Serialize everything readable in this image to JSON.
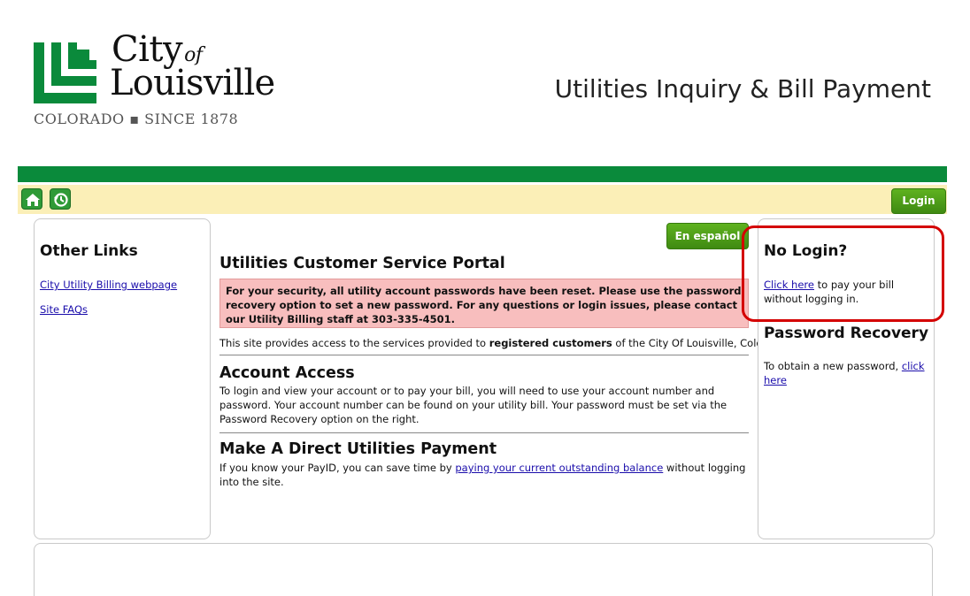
{
  "header": {
    "logo": {
      "city": "City",
      "of": "of",
      "louisville": "Louisville",
      "tagline": "COLORADO ▪ SINCE 1878"
    },
    "app_title": "Utilities Inquiry & Bill Payment"
  },
  "colors": {
    "brand_green": "#0a8a3b",
    "toolbar_yellow": "#fbefb7",
    "button_green": "#4b9e18",
    "alert_pink": "#f8bebe",
    "highlight_red": "#d40000",
    "link_blue": "#1a0dab"
  },
  "toolbar": {
    "home_icon": "home-icon",
    "history_icon": "history-icon",
    "login_label": "Login"
  },
  "left_panel": {
    "title": "Other Links",
    "links": [
      {
        "label": "City Utility Billing webpage"
      },
      {
        "label": "Site FAQs"
      }
    ]
  },
  "main": {
    "espanol_label": "En español",
    "title": "Utilities Customer Service Portal",
    "alert": "For your security, all utility account passwords have been reset. Please use the password recovery option to set a new password. For any questions or login issues, please contact our Utility Billing staff at 303-335-4501.",
    "intro_before": "This site provides access to the services provided to ",
    "intro_bold": "registered customers",
    "intro_after": " of the City Of Louisville, Colorado",
    "account_access": {
      "title": "Account Access",
      "text": "To login and view your account or to pay your bill, you will need to use your account number and password. Your account number can be found on your utility bill. Your password must be set via the Password Recovery option on the right."
    },
    "direct_payment": {
      "title": "Make A Direct Utilities Payment",
      "text_before": "If you know your PayID, you can save time by ",
      "link": "paying your current outstanding balance",
      "text_after": " without logging into the site."
    }
  },
  "right_panel": {
    "no_login": {
      "title": "No Login?",
      "link": "Click here",
      "text": " to pay your bill without logging in."
    },
    "password_recovery": {
      "title": "Password Recovery",
      "text": "To obtain a new password, ",
      "link": "click here"
    }
  }
}
